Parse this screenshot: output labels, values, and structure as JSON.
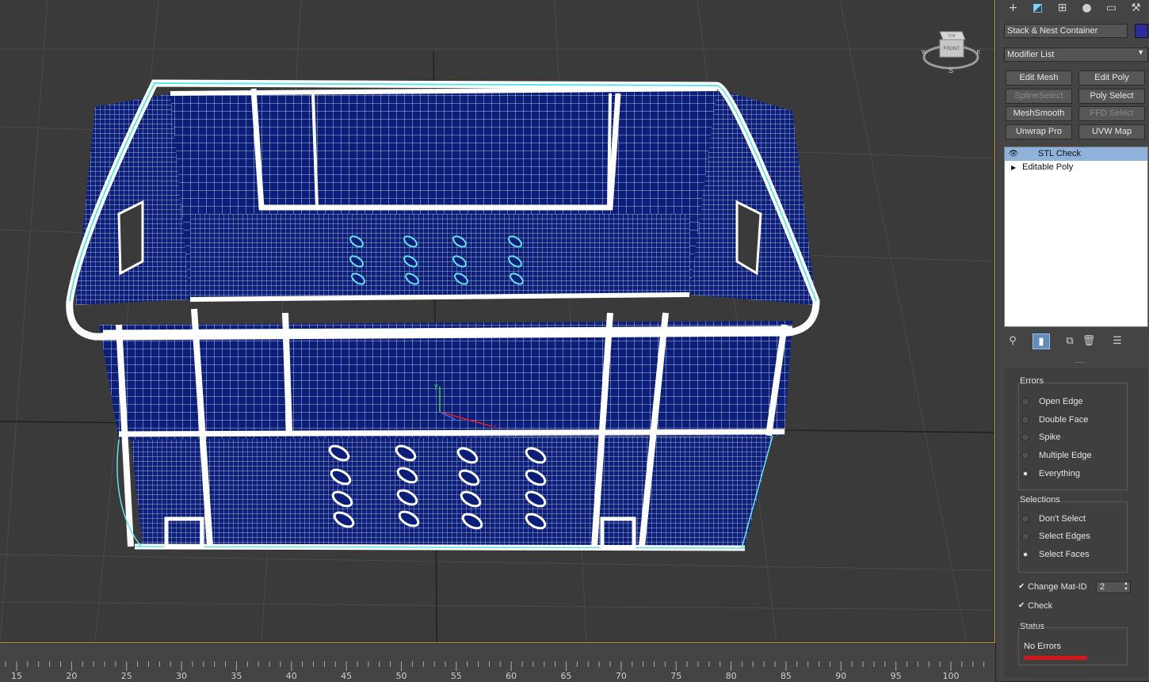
{
  "object_name": "Stack & Nest Container",
  "object_color": "#2d2a9b",
  "modifier_list_label": "Modifier List",
  "modifier_buttons": [
    {
      "label": "Edit Mesh",
      "enabled": true
    },
    {
      "label": "Edit Poly",
      "enabled": true
    },
    {
      "label": "SplineSelect",
      "enabled": false
    },
    {
      "label": "Poly Select",
      "enabled": true
    },
    {
      "label": "MeshSmooth",
      "enabled": true
    },
    {
      "label": "FFD Select",
      "enabled": false
    },
    {
      "label": "Unwrap Pro",
      "enabled": true
    },
    {
      "label": "UVW Map",
      "enabled": true
    }
  ],
  "modifier_stack": [
    {
      "label": "STL Check",
      "selected": true
    },
    {
      "label": "Editable Poly",
      "selected": false
    }
  ],
  "errors": {
    "title": "Errors",
    "options": [
      "Open Edge",
      "Double Face",
      "Spike",
      "Multiple Edge",
      "Everything"
    ],
    "selected": "Everything"
  },
  "selections": {
    "title": "Selections",
    "options": [
      "Don't Select",
      "Select Edges",
      "Select Faces"
    ],
    "selected": "Select Faces"
  },
  "change_mat_id": {
    "label": "Change Mat-ID",
    "checked": true,
    "value": "2"
  },
  "check": {
    "label": "Check",
    "checked": true
  },
  "status": {
    "title": "Status",
    "text": "No Errors",
    "bar_color": "#d6161b"
  },
  "viewcube": {
    "top": "TOP",
    "front": "FRONT",
    "west": "W",
    "east": "E",
    "south": "S"
  },
  "timeline": {
    "ticks": [
      "15",
      "20",
      "25",
      "30",
      "35",
      "40",
      "45",
      "50",
      "55",
      "60",
      "65",
      "70",
      "75",
      "80",
      "85",
      "90",
      "95",
      "100"
    ]
  },
  "tool_icons": [
    "pin-icon",
    "modifier-active-icon",
    "make-unique-icon",
    "delete-icon",
    "configure-icon"
  ],
  "top_tabs": [
    "create-icon",
    "modify-icon",
    "hierarchy-icon",
    "motion-icon",
    "display-icon",
    "utilities-icon"
  ]
}
